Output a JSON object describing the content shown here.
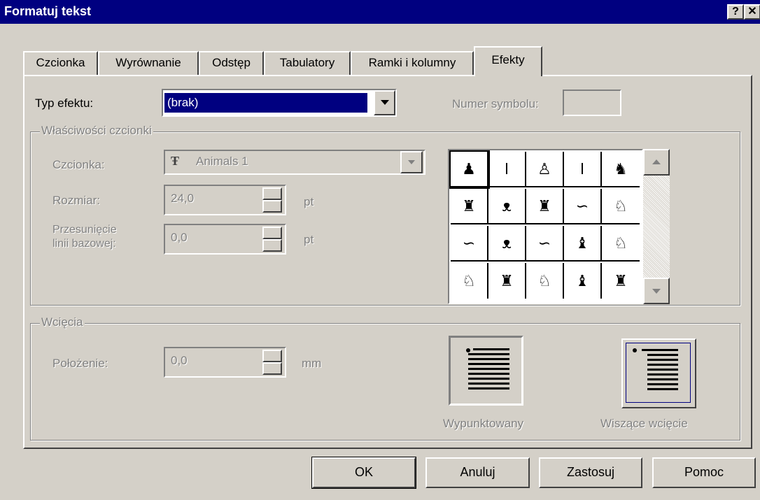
{
  "window": {
    "title": "Formatuj tekst",
    "help_btn": "?",
    "close_btn": "✕"
  },
  "tabs": [
    {
      "label": "Czcionka"
    },
    {
      "label": "Wyrównanie"
    },
    {
      "label": "Odstęp"
    },
    {
      "label": "Tabulatory"
    },
    {
      "label": "Ramki i kolumny"
    },
    {
      "label": "Efekty",
      "active": true
    }
  ],
  "effects": {
    "type_label": "Typ efektu:",
    "type_value": "(brak)",
    "symbol_number_label": "Numer symbolu:",
    "symbol_number_value": ""
  },
  "font_props": {
    "legend": "Właściwości czcionki",
    "font_label": "Czcionka:",
    "font_value": "Animals 1",
    "font_icon": "truetype-icon",
    "size_label": "Rozmiar:",
    "size_value": "24,0",
    "size_unit": "pt",
    "baseline_label_1": "Przesunięcie",
    "baseline_label_2": "linii bazowej:",
    "baseline_value": "0,0",
    "baseline_unit": "pt"
  },
  "symbol_grid": {
    "selected_index": 0,
    "glyphs": [
      "♟",
      "ǀ",
      "♙",
      "ǀ",
      "♞",
      "♜",
      "ᴥ",
      "♜",
      "∽",
      "♘",
      "∽",
      "ᴥ",
      "∽",
      "♝",
      "♘",
      "♘",
      "♜",
      "♘",
      "♝",
      "♜"
    ]
  },
  "indent": {
    "legend": "Wcięcia",
    "position_label": "Położenie:",
    "position_value": "0,0",
    "position_unit": "mm",
    "option1_label": "Wypunktowany",
    "option2_label": "Wiszące wcięcie"
  },
  "buttons": {
    "ok": "OK",
    "cancel": "Anuluj",
    "apply": "Zastosuj",
    "help": "Pomoc"
  }
}
